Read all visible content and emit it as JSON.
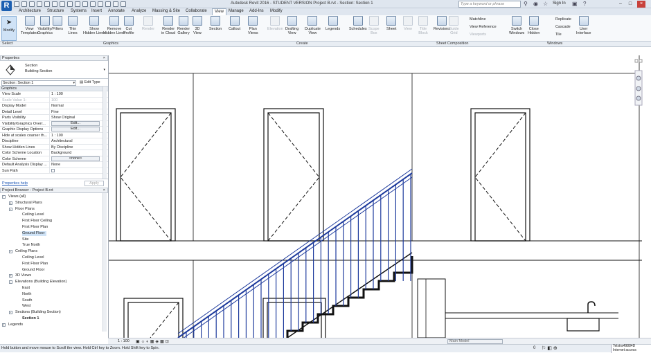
{
  "app": {
    "title": "Autodesk Revit 2016 - STUDENT VERSION     Project B.rvt - Section: Section 1",
    "search_placeholder": "Type a keyword or phrase",
    "sign_in": "Sign In",
    "logo": "R"
  },
  "menu": [
    "Architecture",
    "Structure",
    "Systems",
    "Insert",
    "Annotate",
    "Analyze",
    "Massing & Site",
    "Collaborate",
    "View",
    "Manage",
    "Add-Ins",
    "Modify"
  ],
  "menu_active": "View",
  "ribbon": {
    "modify": "Modify",
    "buttons": [
      {
        "label": "View\nTemplates",
        "state": "normal"
      },
      {
        "label": "Visibility/\nGraphics",
        "state": "normal"
      },
      {
        "label": "Filters",
        "state": "normal"
      },
      {
        "label": "Thin\nLines",
        "state": "normal"
      },
      {
        "label": "Show\nHidden Lines",
        "state": "normal"
      },
      {
        "label": "Remove\nHidden Lines",
        "state": "normal"
      },
      {
        "label": "Cut\nProfile",
        "state": "normal"
      },
      {
        "label": "Render",
        "state": "disabled"
      },
      {
        "label": "Render\nin Cloud",
        "state": "normal"
      },
      {
        "label": "Render\nGallery",
        "state": "normal"
      },
      {
        "label": "3D\nView",
        "state": "normal"
      },
      {
        "label": "Section",
        "state": "normal"
      },
      {
        "label": "Callout",
        "state": "normal"
      },
      {
        "label": "Plan\nViews",
        "state": "normal"
      },
      {
        "label": "Elevation",
        "state": "disabled"
      },
      {
        "label": "Drafting\nView",
        "state": "normal"
      },
      {
        "label": "Duplicate\nView",
        "state": "normal"
      },
      {
        "label": "Legends",
        "state": "normal"
      },
      {
        "label": "Schedules",
        "state": "normal"
      },
      {
        "label": "Scope\nBox",
        "state": "disabled"
      },
      {
        "label": "Sheet",
        "state": "normal"
      },
      {
        "label": "View",
        "state": "disabled"
      },
      {
        "label": "Title\nBlock",
        "state": "disabled"
      },
      {
        "label": "Revisions",
        "state": "normal"
      },
      {
        "label": "Guide\nGrid",
        "state": "disabled"
      },
      {
        "label": "Switch\nWindows",
        "state": "normal"
      },
      {
        "label": "Close\nHidden",
        "state": "normal"
      },
      {
        "label": "User\nInterface",
        "state": "normal"
      }
    ],
    "small_items": {
      "matchline": "Matchline",
      "view_reference": "View  Reference",
      "viewports": "Viewports",
      "replicate": "Replicate",
      "cascade": "Cascade",
      "tile": "Tile"
    },
    "panels": [
      "Select",
      "Graphics",
      "Create",
      "Sheet Composition",
      "Windows"
    ]
  },
  "properties": {
    "title": "Properties",
    "type_family": "Section",
    "type_name": "Building Section",
    "selector": "Section: Section 1",
    "edit_type": "Edit Type",
    "group": "Graphics",
    "rows": [
      {
        "k": "View Scale",
        "v": "1 : 100",
        "kind": "text"
      },
      {
        "k": "Scale Value    1:",
        "v": "100",
        "kind": "dis"
      },
      {
        "k": "Display Model",
        "v": "Normal",
        "kind": "text"
      },
      {
        "k": "Detail Level",
        "v": "Fine",
        "kind": "text"
      },
      {
        "k": "Parts Visibility",
        "v": "Show Original",
        "kind": "text"
      },
      {
        "k": "Visibility/Graphics Overr...",
        "v": "Edit...",
        "kind": "btn"
      },
      {
        "k": "Graphic Display Options",
        "v": "Edit...",
        "kind": "btn"
      },
      {
        "k": "Hide at scales coarser th...",
        "v": "1 : 100",
        "kind": "text"
      },
      {
        "k": "Discipline",
        "v": "Architectural",
        "kind": "text"
      },
      {
        "k": "Show Hidden Lines",
        "v": "By Discipline",
        "kind": "text"
      },
      {
        "k": "Color Scheme Location",
        "v": "Background",
        "kind": "text"
      },
      {
        "k": "Color Scheme",
        "v": "<none>",
        "kind": "btn"
      },
      {
        "k": "Default Analysis Display ...",
        "v": "None",
        "kind": "text"
      },
      {
        "k": "Sun Path",
        "v": "",
        "kind": "chk"
      }
    ],
    "help": "Properties help",
    "apply": "Apply"
  },
  "browser": {
    "title": "Project Browser - Project B.rvt",
    "nodes": [
      {
        "t": "Views (all)",
        "lvl": 0,
        "tog": "-"
      },
      {
        "t": "Structural Plans",
        "lvl": 1,
        "tog": "+"
      },
      {
        "t": "Floor Plans",
        "lvl": 1,
        "tog": "-"
      },
      {
        "t": "Ceiling Level",
        "lvl": 2
      },
      {
        "t": "First Floor Ceiling",
        "lvl": 2
      },
      {
        "t": "First Floor Plan",
        "lvl": 2
      },
      {
        "t": "Ground Floor",
        "lvl": 2,
        "sel": true
      },
      {
        "t": "Site",
        "lvl": 2
      },
      {
        "t": "True North",
        "lvl": 2
      },
      {
        "t": "Ceiling Plans",
        "lvl": 1,
        "tog": "-"
      },
      {
        "t": "Ceiling Level",
        "lvl": 2
      },
      {
        "t": "First Floor Plan",
        "lvl": 2
      },
      {
        "t": "Ground Floor",
        "lvl": 2
      },
      {
        "t": "3D Views",
        "lvl": 1,
        "tog": "+"
      },
      {
        "t": "Elevations (Building Elevation)",
        "lvl": 1,
        "tog": "-"
      },
      {
        "t": "East",
        "lvl": 2
      },
      {
        "t": "North",
        "lvl": 2
      },
      {
        "t": "South",
        "lvl": 2
      },
      {
        "t": "West",
        "lvl": 2
      },
      {
        "t": "Sections (Building Section)",
        "lvl": 1,
        "tog": "-"
      },
      {
        "t": "Section 1",
        "lvl": 2,
        "bold": true
      },
      {
        "t": "Legends",
        "lvl": 0,
        "tog": "+"
      }
    ]
  },
  "viewbar": {
    "scale": "1 : 100",
    "model": "Main Model"
  },
  "status": {
    "message": "Hold button and move mouse to Scroll the view. Hold Ctrl key to Zoom. Hold Shift key to Spin.",
    "isp": "Telstra49884D",
    "isp_sub": "Internet access",
    "level": "0"
  }
}
